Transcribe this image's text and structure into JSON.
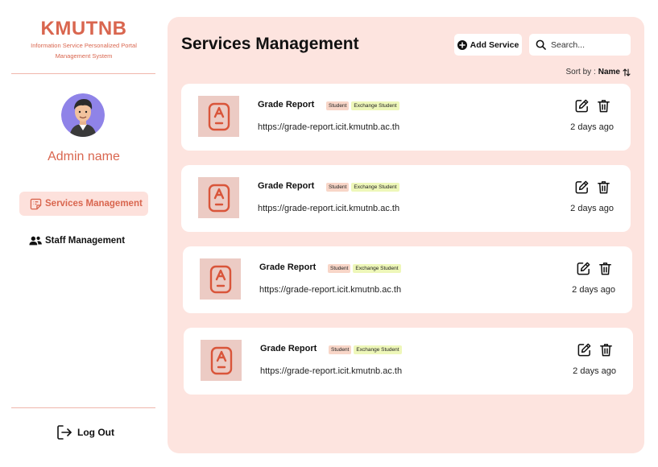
{
  "brand": {
    "title": "KMUTNB",
    "subtitle_line1": "Information Service Personalized Portal",
    "subtitle_line2": "Management System"
  },
  "admin": {
    "name": "Admin name"
  },
  "nav": {
    "items": [
      {
        "label": "Services Management",
        "icon": "services-icon",
        "active": true
      },
      {
        "label": "Staff Management",
        "icon": "users-icon",
        "active": false
      }
    ],
    "logout_label": "Log Out"
  },
  "main": {
    "title": "Services Management",
    "add_button_label": "Add Service",
    "search_placeholder": "Search...",
    "sort_prefix": "Sort by :",
    "sort_value": "Name"
  },
  "services": [
    {
      "name": "Grade Report",
      "tags": [
        "Student",
        "Exchange Student"
      ],
      "url": "https://grade-report.icit.kmutnb.ac.th",
      "updated": "2 days ago"
    },
    {
      "name": "Grade Report",
      "tags": [
        "Student",
        "Exchange Student"
      ],
      "url": "https://grade-report.icit.kmutnb.ac.th",
      "updated": "2 days ago"
    },
    {
      "name": "Grade Report",
      "tags": [
        "Student",
        "Exchange Student"
      ],
      "url": "https://grade-report.icit.kmutnb.ac.th",
      "updated": "2 days ago"
    },
    {
      "name": "Grade Report",
      "tags": [
        "Student",
        "Exchange Student"
      ],
      "url": "https://grade-report.icit.kmutnb.ac.th",
      "updated": "2 days ago"
    }
  ],
  "colors": {
    "brand": "#d9664f",
    "panel_bg": "#fde4df",
    "active_nav_bg": "#fde1dc",
    "thumb_bg": "#eccbc4",
    "badge_student": "#f8d6c8",
    "badge_exchange": "#eef7b9"
  }
}
